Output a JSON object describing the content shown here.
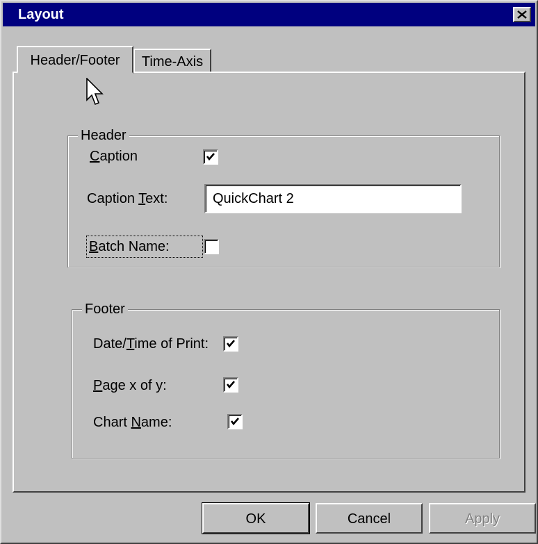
{
  "window": {
    "title": "Layout",
    "close_icon": "close-icon"
  },
  "tabs": [
    {
      "label": "Header/Footer",
      "active": true
    },
    {
      "label": "Time-Axis",
      "active": false
    }
  ],
  "header_group": {
    "legend": "Header",
    "caption": {
      "label_first": "C",
      "label_rest": "aption",
      "checked": true
    },
    "caption_text": {
      "label_before": "Caption ",
      "label_ul": "T",
      "label_after": "ext:",
      "value": "QuickChart 2"
    },
    "batch_name": {
      "label_first": "B",
      "label_rest": "atch Name:",
      "checked": false
    }
  },
  "footer_group": {
    "legend": "Footer",
    "date_time": {
      "label_before": "Date/",
      "label_ul": "T",
      "label_after": "ime of Print:",
      "checked": true
    },
    "page_x_of_y": {
      "label_first": "P",
      "label_rest": "age x of y:",
      "checked": true
    },
    "chart_name": {
      "label_before": "Chart ",
      "label_ul": "N",
      "label_after": "ame:",
      "checked": true
    }
  },
  "buttons": {
    "ok": "OK",
    "cancel": "Cancel",
    "apply": "Apply",
    "apply_enabled": false
  },
  "colors": {
    "titlebar": "#00007f",
    "face": "#c0c0c0"
  }
}
